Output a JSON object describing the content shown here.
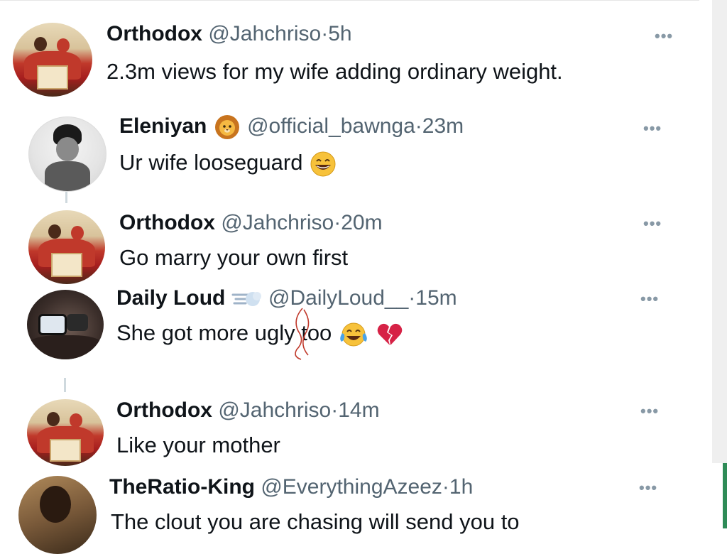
{
  "tweets": [
    {
      "name": "Orthodox",
      "handle": "@Jahchriso",
      "sep": "·",
      "time": "5h",
      "text": "2.3m views for my wife adding ordinary weight.",
      "more": "•••",
      "avatar": "family-photo"
    },
    {
      "name": "Eleniyan",
      "handle": "@official_bawnga",
      "sep": "·",
      "time": "23m",
      "text": "Ur wife looseguard",
      "more": "•••",
      "avatar": "boy-photo",
      "name_emoji": "lion-face",
      "text_emoji": "grinning-face"
    },
    {
      "name": "Orthodox",
      "handle": "@Jahchriso",
      "sep": "·",
      "time": "20m",
      "text": "Go marry your own first",
      "more": "•••",
      "avatar": "family-photo"
    },
    {
      "name": "Daily Loud",
      "handle": "@DailyLoud__",
      "sep": "·",
      "time": "15m",
      "text": "She got more ugly too",
      "more": "•••",
      "avatar": "glasses-photo",
      "name_emoji": "dash",
      "text_emoji_1": "tears-of-joy",
      "text_emoji_2": "broken-heart"
    },
    {
      "name": "Orthodox",
      "handle": "@Jahchriso",
      "sep": "·",
      "time": "14m",
      "text": "Like your mother",
      "more": "•••",
      "avatar": "family-photo"
    },
    {
      "name": "TheRatio-King",
      "handle": "@EverythingAzeez",
      "sep": "·",
      "time": "1h",
      "text": "The clout you are chasing will send you to",
      "more": "•••",
      "avatar": "man-photo"
    }
  ],
  "colors": {
    "name": "#0f1419",
    "meta": "#536471",
    "more": "#8899a6",
    "thread": "#cfd9de",
    "scrollbar": "#efefef",
    "accent_green": "#2e8b57"
  }
}
